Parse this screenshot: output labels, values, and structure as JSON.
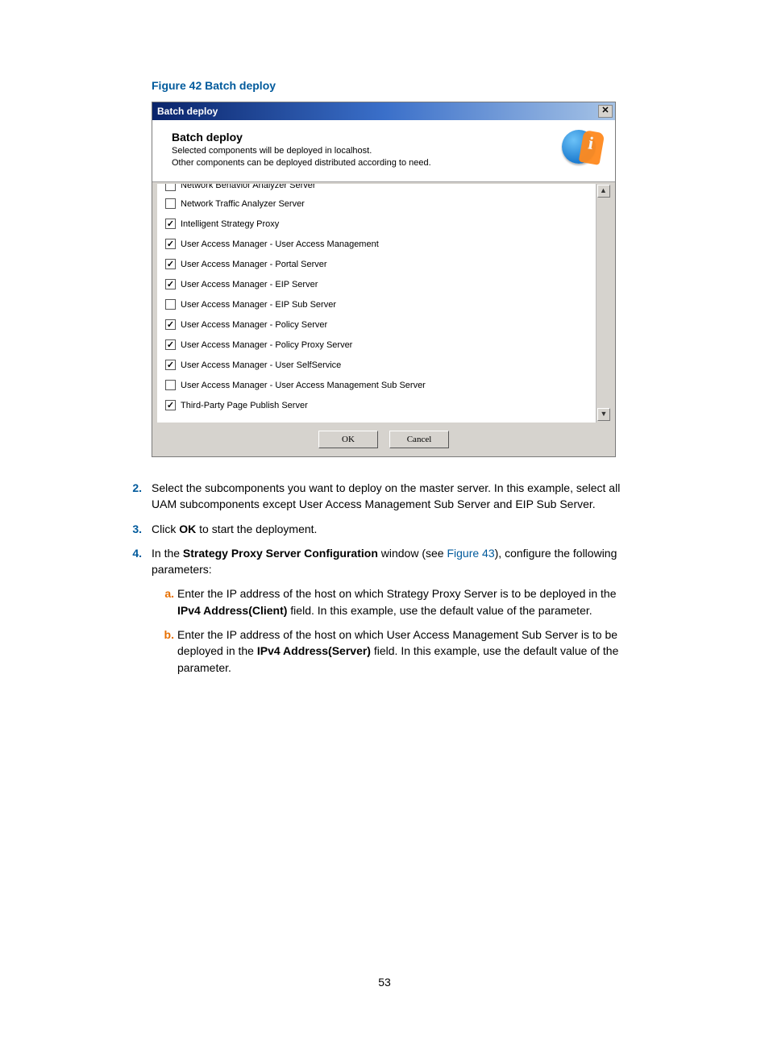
{
  "figure_caption": "Figure 42 Batch deploy",
  "dialog": {
    "title": "Batch deploy",
    "header_title": "Batch deploy",
    "header_line1": "Selected components will be deployed in localhost.",
    "header_line2": "Other components can be deployed distributed according to need.",
    "items": [
      {
        "label": "Network Behavior Analyzer Server",
        "checked": false
      },
      {
        "label": "Network Traffic Analyzer Server",
        "checked": false
      },
      {
        "label": "Intelligent Strategy Proxy",
        "checked": true
      },
      {
        "label": "User Access Manager - User Access Management",
        "checked": true
      },
      {
        "label": "User Access Manager - Portal Server",
        "checked": true
      },
      {
        "label": "User Access Manager - EIP Server",
        "checked": true
      },
      {
        "label": "User Access Manager - EIP Sub Server",
        "checked": false
      },
      {
        "label": "User Access Manager - Policy Server",
        "checked": true
      },
      {
        "label": "User Access Manager - Policy Proxy Server",
        "checked": true
      },
      {
        "label": "User Access Manager - User SelfService",
        "checked": true
      },
      {
        "label": "User Access Manager - User Access Management Sub Server",
        "checked": false
      },
      {
        "label": "Third-Party Page Publish Server",
        "checked": true
      }
    ],
    "ok_label": "OK",
    "cancel_label": "Cancel"
  },
  "steps": {
    "s2_num": "2.",
    "s2": "Select the subcomponents you want to deploy on the master server. In this example, select all UAM subcomponents except User Access Management Sub Server and EIP Sub Server.",
    "s3_num": "3.",
    "s3_a": "Click ",
    "s3_b": "OK",
    "s3_c": " to start the deployment.",
    "s4_num": "4.",
    "s4_a": "In the ",
    "s4_b": "Strategy Proxy Server Configuration",
    "s4_c": " window (see ",
    "s4_link": "Figure 43",
    "s4_d": "), configure the following parameters:",
    "a_num": "a.",
    "a_1": "Enter the IP address of the host on which Strategy Proxy Server is to be deployed in the ",
    "a_2": "IPv4 Address(Client)",
    "a_3": " field. In this example, use the default value of the parameter.",
    "b_num": "b.",
    "b_1": "Enter the IP address of the host on which User Access Management Sub Server is to be deployed in the ",
    "b_2": "IPv4 Address(Server)",
    "b_3": " field. In this example, use the default value of the parameter."
  },
  "page_number": "53"
}
